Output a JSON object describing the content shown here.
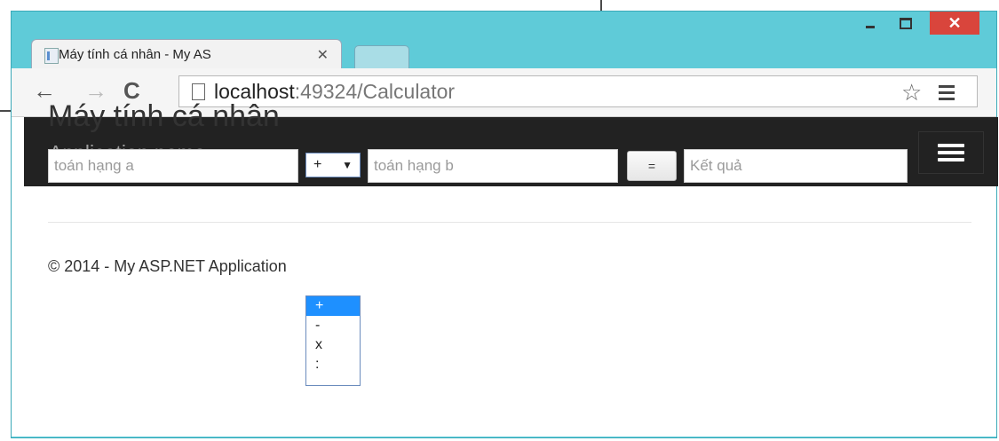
{
  "window": {
    "controls": {
      "minimize": "minimize",
      "maximize": "maximize",
      "close": "✕"
    }
  },
  "tabs": [
    {
      "title": "Máy tính cá nhân - My AS",
      "close": "✕"
    }
  ],
  "toolbar": {
    "back": "←",
    "forward": "→",
    "reload": "C",
    "url_host": "localhost",
    "url_rest": ":49324/Calculator",
    "star": "☆"
  },
  "navbar": {
    "brand": "Application name"
  },
  "page": {
    "title": "Máy tính cá nhân",
    "operand_a_placeholder": "toán hạng a",
    "operator_selected": "+",
    "operator_arrow": "▼",
    "operand_b_placeholder": "toán hạng b",
    "equals_label": "=",
    "result_placeholder": "Kết quả",
    "operator_options": [
      "+",
      "-",
      "x",
      ":"
    ]
  },
  "footer": {
    "text": "© 2014 - My ASP.NET Application"
  },
  "colors": {
    "window_frame": "#5fcbd8",
    "navbar_bg": "#222222",
    "close_button": "#d9453c",
    "selected_option": "#1e90ff"
  }
}
